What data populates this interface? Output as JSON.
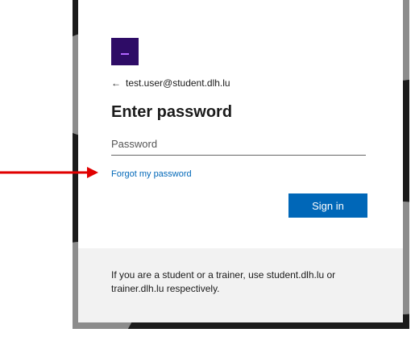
{
  "signin": {
    "identity": "test.user@student.dlh.lu",
    "back_arrow_glyph": "←",
    "title": "Enter password",
    "password_placeholder": "Password",
    "forgot_link": "Forgot my password",
    "submit_label": "Sign in"
  },
  "footer": {
    "text": "If you are a student or a trainer, use student.dlh.lu or trainer.dlh.lu respectively."
  },
  "icons": {
    "logo": "logo-icon",
    "back": "back-arrow-icon",
    "annotation": "red-arrow-annotation"
  },
  "colors": {
    "accent": "#0067b8",
    "logo_bg": "#2e0c66",
    "annotation": "#e00000"
  }
}
